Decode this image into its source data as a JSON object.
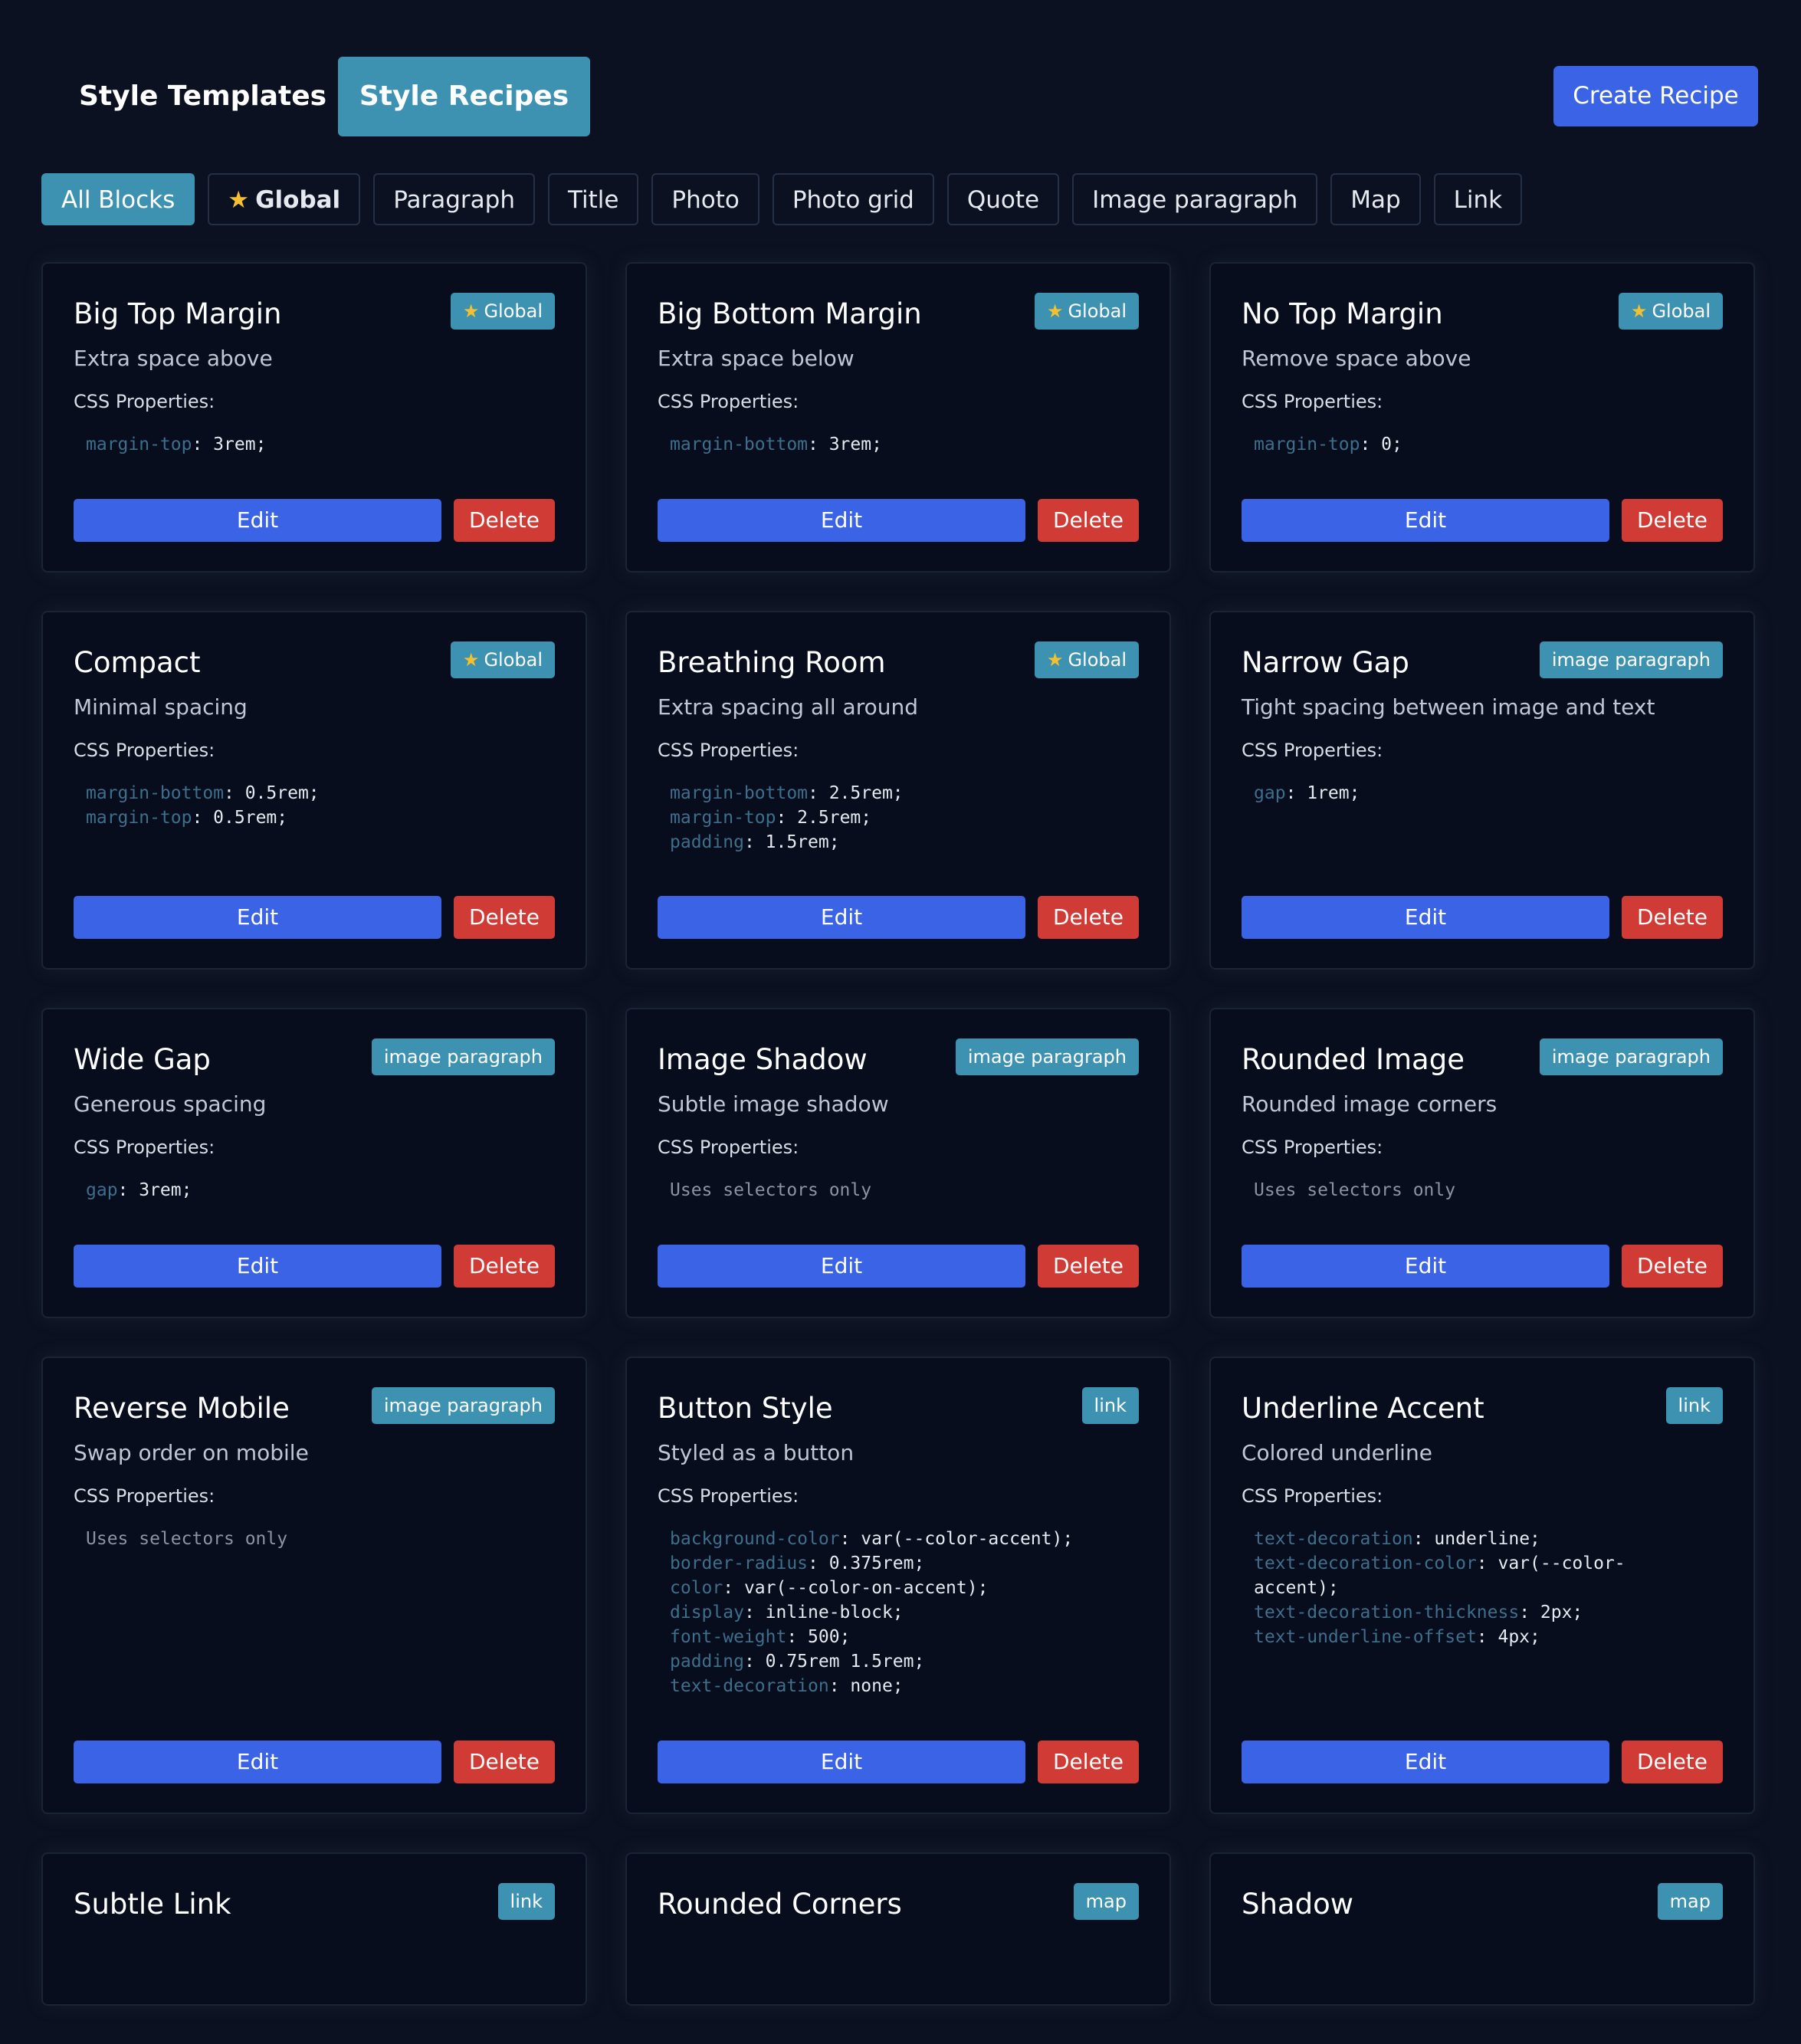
{
  "tabs": {
    "templates": "Style Templates",
    "recipes": "Style Recipes"
  },
  "create_button": "Create Recipe",
  "filters": [
    "All Blocks",
    "Global",
    "Paragraph",
    "Title",
    "Photo",
    "Photo grid",
    "Quote",
    "Image paragraph",
    "Map",
    "Link"
  ],
  "card_labels": {
    "css_properties": "CSS Properties:",
    "edit": "Edit",
    "delete": "Delete"
  },
  "cards": [
    {
      "title": "Big Top Margin",
      "badge": "Global",
      "global": true,
      "desc": "Extra space above",
      "props": [
        [
          "margin-top",
          "3rem"
        ]
      ]
    },
    {
      "title": "Big Bottom Margin",
      "badge": "Global",
      "global": true,
      "desc": "Extra space below",
      "props": [
        [
          "margin-bottom",
          "3rem"
        ]
      ]
    },
    {
      "title": "No Top Margin",
      "badge": "Global",
      "global": true,
      "desc": "Remove space above",
      "props": [
        [
          "margin-top",
          "0"
        ]
      ]
    },
    {
      "title": "Compact",
      "badge": "Global",
      "global": true,
      "desc": "Minimal spacing",
      "props": [
        [
          "margin-bottom",
          "0.5rem"
        ],
        [
          "margin-top",
          "0.5rem"
        ]
      ]
    },
    {
      "title": "Breathing Room",
      "badge": "Global",
      "global": true,
      "desc": "Extra spacing all around",
      "props": [
        [
          "margin-bottom",
          "2.5rem"
        ],
        [
          "margin-top",
          "2.5rem"
        ],
        [
          "padding",
          "1.5rem"
        ]
      ]
    },
    {
      "title": "Narrow Gap",
      "badge": "image paragraph",
      "global": false,
      "desc": "Tight spacing between image and text",
      "props": [
        [
          "gap",
          "1rem"
        ]
      ]
    },
    {
      "title": "Wide Gap",
      "badge": "image paragraph",
      "global": false,
      "desc": "Generous spacing",
      "props": [
        [
          "gap",
          "3rem"
        ]
      ]
    },
    {
      "title": "Image Shadow",
      "badge": "image paragraph",
      "global": false,
      "desc": "Subtle image shadow",
      "props": [],
      "empty": "Uses selectors only"
    },
    {
      "title": "Rounded Image",
      "badge": "image paragraph",
      "global": false,
      "desc": "Rounded image corners",
      "props": [],
      "empty": "Uses selectors only"
    },
    {
      "title": "Reverse Mobile",
      "badge": "image paragraph",
      "global": false,
      "desc": "Swap order on mobile",
      "props": [],
      "empty": "Uses selectors only"
    },
    {
      "title": "Button Style",
      "badge": "link",
      "global": false,
      "desc": "Styled as a button",
      "props": [
        [
          "background-color",
          "var(--color-accent)"
        ],
        [
          "border-radius",
          "0.375rem"
        ],
        [
          "color",
          "var(--color-on-accent)"
        ],
        [
          "display",
          "inline-block"
        ],
        [
          "font-weight",
          "500"
        ],
        [
          "padding",
          "0.75rem 1.5rem"
        ],
        [
          "text-decoration",
          "none"
        ]
      ]
    },
    {
      "title": "Underline Accent",
      "badge": "link",
      "global": false,
      "desc": "Colored underline",
      "props": [
        [
          "text-decoration",
          "underline"
        ],
        [
          "text-decoration-color",
          "var(--color-\naccent)"
        ],
        [
          "text-decoration-thickness",
          "2px"
        ],
        [
          "text-underline-offset",
          "4px"
        ]
      ]
    },
    {
      "title": "Subtle Link",
      "badge": "link",
      "global": false,
      "desc": "",
      "props": []
    },
    {
      "title": "Rounded Corners",
      "badge": "map",
      "global": false,
      "desc": "",
      "props": []
    },
    {
      "title": "Shadow",
      "badge": "map",
      "global": false,
      "desc": "",
      "props": []
    }
  ],
  "colors": {
    "background": "#0b1120",
    "accent": "#3d91b1",
    "primary": "#3b63e6",
    "danger": "#d13b35"
  }
}
